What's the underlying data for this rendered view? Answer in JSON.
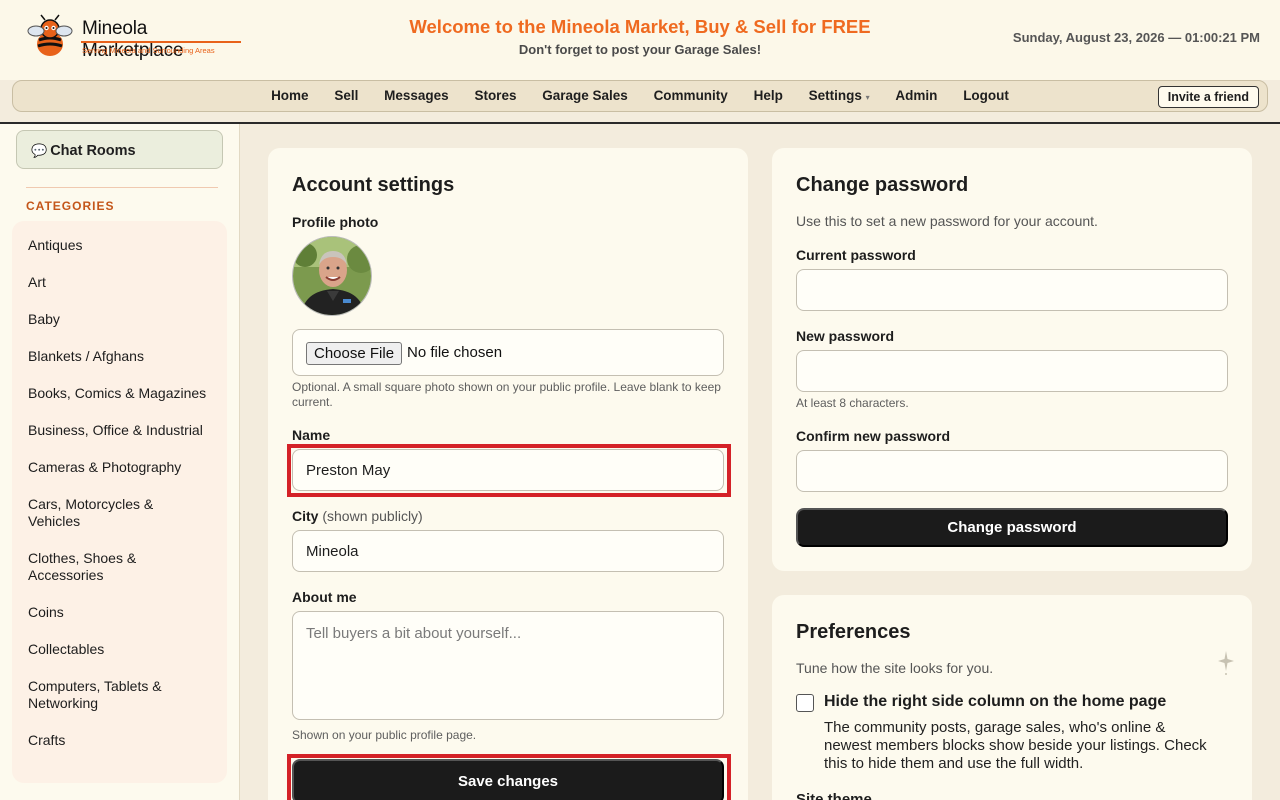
{
  "header": {
    "brand": "Mineola Marketplace",
    "tagline": "Serving Mineola and Surrounding Areas",
    "welcome": "Welcome to the Mineola Market, Buy & Sell for FREE",
    "subwelcome": "Don't forget to post your Garage Sales!",
    "datetime": "Sunday, August 23, 2026 — 01:00:21 PM"
  },
  "nav": {
    "items": [
      "Home",
      "Sell",
      "Messages",
      "Stores",
      "Garage Sales",
      "Community",
      "Help",
      "Settings",
      "Admin",
      "Logout"
    ],
    "caret": "▾",
    "invite": "Invite a friend"
  },
  "sidebar": {
    "chat_icon": "💬",
    "chat_label": "Chat Rooms",
    "categories_heading": "CATEGORIES",
    "categories": [
      "Antiques",
      "Art",
      "Baby",
      "Blankets / Afghans",
      "Books, Comics & Magazines",
      "Business, Office & Industrial",
      "Cameras & Photography",
      "Cars, Motorcycles & Vehicles",
      "Clothes, Shoes & Accessories",
      "Coins",
      "Collectables",
      "Computers, Tablets & Networking",
      "Crafts"
    ]
  },
  "account": {
    "title": "Account settings",
    "photo_label": "Profile photo",
    "file_button": "Choose File",
    "file_status": "No file chosen",
    "photo_hint": "Optional. A small square photo shown on your public profile. Leave blank to keep current.",
    "name_label": "Name",
    "name_value": "Preston May",
    "city_label": "City",
    "city_note": "(shown publicly)",
    "city_value": "Mineola",
    "about_label": "About me",
    "about_placeholder": "Tell buyers a bit about yourself...",
    "about_hint": "Shown on your public profile page.",
    "save_label": "Save changes"
  },
  "password": {
    "title": "Change password",
    "intro": "Use this to set a new password for your account.",
    "current_label": "Current password",
    "new_label": "New password",
    "new_hint": "At least 8 characters.",
    "confirm_label": "Confirm new password",
    "button": "Change password"
  },
  "prefs": {
    "title": "Preferences",
    "intro": "Tune how the site looks for you.",
    "hide_label": "Hide the right side column on the home page",
    "hide_desc": "The community posts, garage sales, who's online & newest members blocks show beside your listings. Check this to hide them and use the full width.",
    "theme_label": "Site theme"
  },
  "colors": {
    "accent": "#ef6a20",
    "highlight": "#d42127",
    "button_dark": "#1b1b1b"
  }
}
